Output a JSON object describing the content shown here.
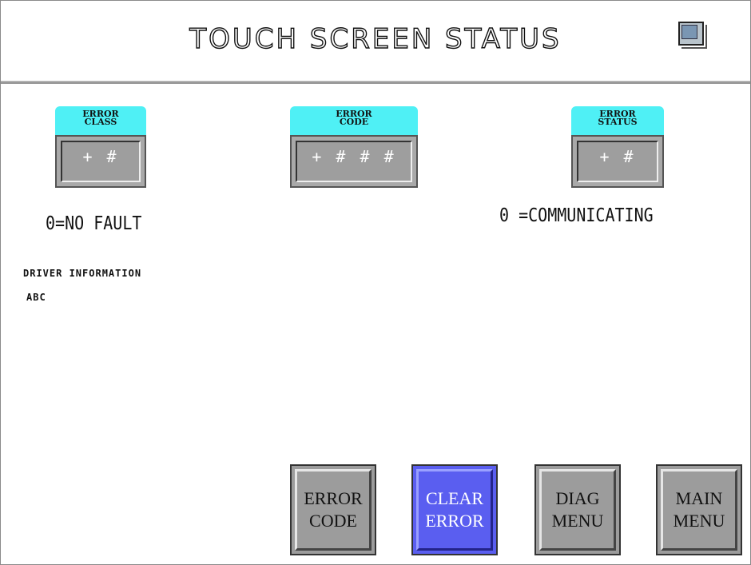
{
  "header": {
    "title": "TOUCH SCREEN STATUS",
    "icon": "monitor-icon"
  },
  "fields": [
    {
      "label_line1": "ERROR",
      "label_line2": "CLASS",
      "value": "+ #"
    },
    {
      "label_line1": "ERROR",
      "label_line2": "CODE",
      "value": "+ # # #"
    },
    {
      "label_line1": "ERROR",
      "label_line2": "STATUS",
      "value": "+ #"
    }
  ],
  "messages": {
    "class_text": "0=NO FAULT",
    "status_text": "0 =COMMUNICATING"
  },
  "driver": {
    "heading": "DRIVER INFORMATION",
    "value": "ABC"
  },
  "buttons": [
    {
      "line1": "ERROR",
      "line2": "CODE"
    },
    {
      "line1": "CLEAR",
      "line2": "ERROR"
    },
    {
      "line1": "DIAG",
      "line2": "MENU"
    },
    {
      "line1": "MAIN",
      "line2": "MENU"
    }
  ],
  "colors": {
    "label_bg": "#4ff0f5",
    "active_button": "#5a5ef0",
    "panel_gray": "#9e9e9e"
  }
}
